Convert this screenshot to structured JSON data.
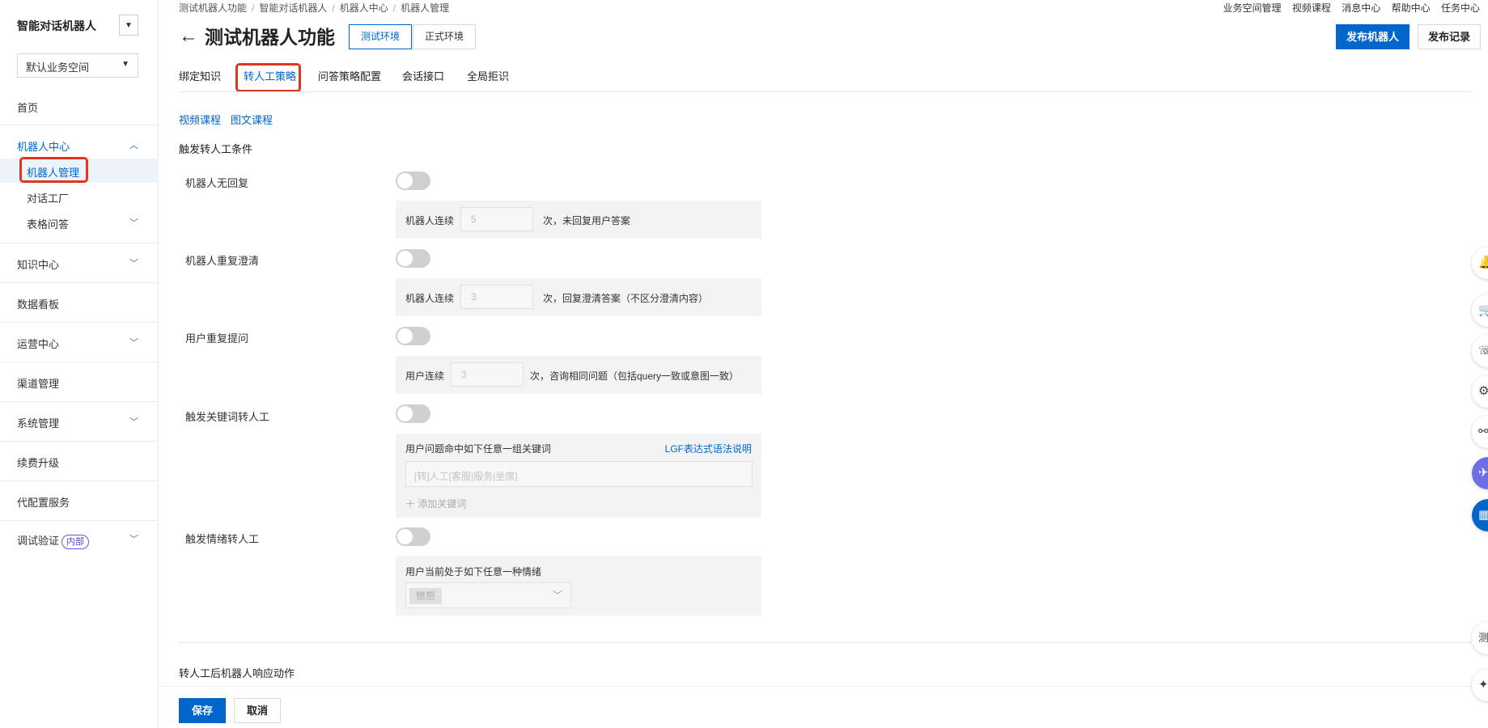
{
  "sidebar": {
    "title": "智能对话机器人",
    "workspace": "默认业务空间",
    "items": [
      {
        "label": "首页"
      },
      {
        "label": "机器人中心"
      },
      {
        "label": "机器人管理"
      },
      {
        "label": "对话工厂"
      },
      {
        "label": "表格问答"
      },
      {
        "label": "知识中心"
      },
      {
        "label": "数据看板"
      },
      {
        "label": "运营中心"
      },
      {
        "label": "渠道管理"
      },
      {
        "label": "系统管理"
      },
      {
        "label": "续费升级"
      },
      {
        "label": "代配置服务"
      },
      {
        "label": "调试验证"
      }
    ],
    "badge": "内部"
  },
  "breadcrumb": [
    "测试机器人功能",
    "智能对话机器人",
    "机器人中心",
    "机器人管理"
  ],
  "topnav": [
    "业务空间管理",
    "视频课程",
    "消息中心",
    "帮助中心",
    "任务中心"
  ],
  "header": {
    "title": "测试机器人功能",
    "env_test": "测试环境",
    "env_prod": "正式环境",
    "publish": "发布机器人",
    "publish_log": "发布记录"
  },
  "tabs": [
    "绑定知识",
    "转人工策略",
    "问答策略配置",
    "会话接口",
    "全局拒识"
  ],
  "links": {
    "video": "视频课程",
    "doc": "图文课程"
  },
  "section1_title": "触发转人工条件",
  "conditions": {
    "no_reply": {
      "label": "机器人无回复",
      "prefix": "机器人连续",
      "value": "5",
      "suffix": "次，未回复用户答案",
      "enabled": false
    },
    "repeat_clarify": {
      "label": "机器人重复澄清",
      "prefix": "机器人连续",
      "value": "3",
      "suffix": "次，回复澄清答案（不区分澄清内容）",
      "enabled": false
    },
    "repeat_ask": {
      "label": "用户重复提问",
      "prefix": "用户连续",
      "value": "3",
      "suffix": "次，咨询相同问题（包括query一致或意图一致）",
      "enabled": false
    },
    "keyword": {
      "label": "触发关键词转人工",
      "hint": "用户问题命中如下任意一组关键词",
      "help_link": "LGF表达式语法说明",
      "placeholder": "[转]人工[客服|服务|坐席]",
      "add": "添加关键词",
      "enabled": false
    },
    "emotion": {
      "label": "触发情绪转人工",
      "hint": "用户当前处于如下任意一种情绪",
      "selected": "愤怒",
      "enabled": false
    }
  },
  "section2_title": "转人工后机器人响应动作",
  "footer": {
    "save": "保存",
    "cancel": "取消"
  },
  "float_tools": [
    "bell-icon",
    "cart-icon",
    "headset-icon",
    "gear-icon",
    "link-icon",
    "plane-icon",
    "grid-icon"
  ],
  "float_labels": {
    "test": "测"
  },
  "colors": {
    "primary": "#0066cc",
    "highlight": "#e0361f",
    "badge": "#5b3fd6"
  }
}
